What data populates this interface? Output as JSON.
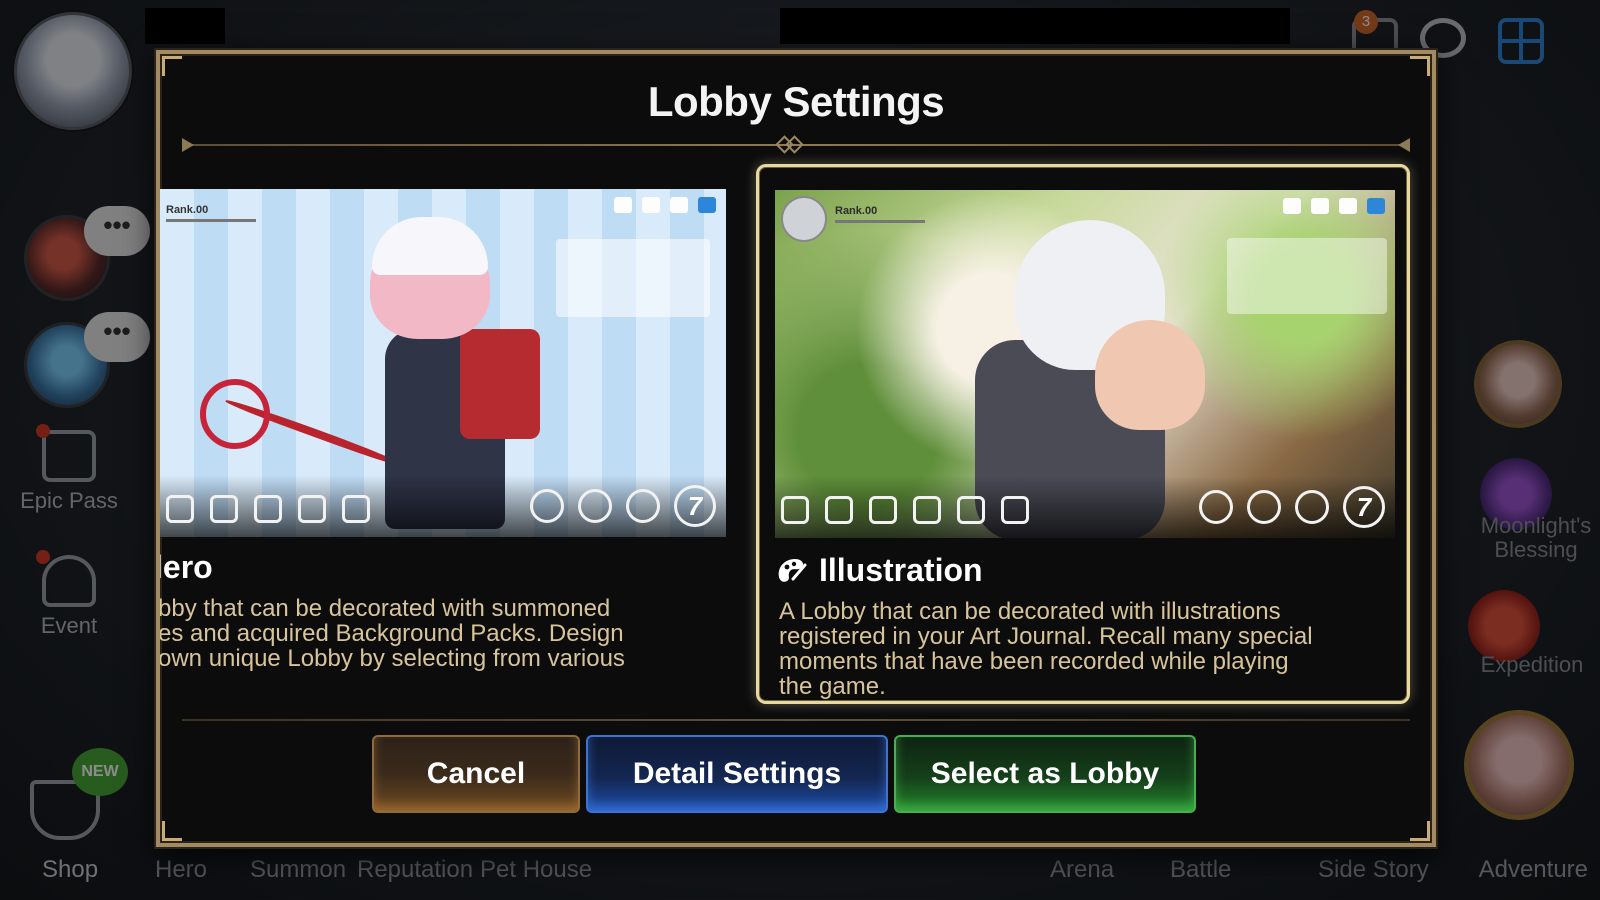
{
  "modal": {
    "title": "Lobby Settings",
    "buttons": {
      "cancel": "Cancel",
      "detail": "Detail Settings",
      "select": "Select as Lobby"
    },
    "options": [
      {
        "title": "Hero",
        "title_visible": "lero",
        "selected": false,
        "preview_rank": "Rank.00",
        "preview_badge": "7",
        "description_lines": [
          "bby that can be decorated with summoned",
          "es and acquired Background Packs. Design",
          "own unique Lobby by selecting from various"
        ]
      },
      {
        "title": "Illustration",
        "selected": true,
        "icon": "palette-icon",
        "preview_rank": "Rank.00",
        "preview_badge": "7",
        "description_lines": [
          "A Lobby that can be decorated with illustrations",
          "registered in your Art Journal. Recall many special",
          "moments that have been recorded while playing",
          "the game."
        ]
      }
    ]
  },
  "background": {
    "left_menu": {
      "epic_pass": "Epic Pass",
      "event": "Event",
      "shop": "Shop",
      "new_badge": "NEW"
    },
    "bottom_menu": [
      "Hero",
      "Summon",
      "Reputation",
      "Pet House",
      "Arena",
      "Battle",
      "Side Story",
      "Adventure"
    ],
    "right_menu": {
      "moonlight": "Moonlight's Blessing",
      "expedition": "Expedition"
    },
    "mail_count": "3",
    "chat_bubble": "•••"
  },
  "colors": {
    "frame_gold": "#a38a62",
    "selected_border": "#e8d9a1",
    "description_text": "#d8c49a",
    "cancel_button": "#6f4a22",
    "detail_button": "#1e4ea6",
    "select_button": "#24862c"
  }
}
